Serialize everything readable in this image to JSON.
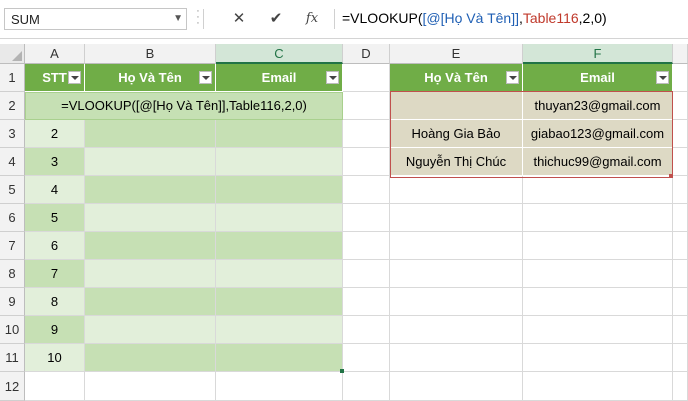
{
  "formula_bar": {
    "name_box": "SUM",
    "cancel_icon": "✕",
    "enter_icon": "✔",
    "fx_label": "fx",
    "formula_parts": [
      {
        "text": "=VLOOKUP(",
        "color": "#000000"
      },
      {
        "text": "[@[Họ Và Tên]]",
        "color": "#1f5fb4"
      },
      {
        "text": ",",
        "color": "#000000"
      },
      {
        "text": "Table116",
        "color": "#c0392b"
      },
      {
        "text": ",2,0)",
        "color": "#000000"
      }
    ]
  },
  "columns": [
    "A",
    "B",
    "C",
    "D",
    "E",
    "F"
  ],
  "rows": [
    "1",
    "2",
    "3",
    "4",
    "5",
    "6",
    "7",
    "8",
    "9",
    "10",
    "11",
    "12"
  ],
  "table_left": {
    "headers": [
      "STT",
      "Họ Và Tên",
      "Email"
    ],
    "stt": [
      "2",
      "3",
      "4",
      "5",
      "6",
      "7",
      "8",
      "9",
      "10"
    ]
  },
  "edit_cell": {
    "formula": "=VLOOKUP([@[Họ Và Tên]],Table116,2,0)"
  },
  "table_right": {
    "headers": [
      "Họ Và Tên",
      "Email"
    ],
    "rows": [
      {
        "name": "",
        "email": "thuyan23@gmail.com"
      },
      {
        "name": "Hoàng Gia Bảo",
        "email": "giabao123@gmail.com"
      },
      {
        "name": "Nguyễn Thị Chúc",
        "email": "thichuc99@gmail.com"
      }
    ]
  },
  "colors": {
    "header_green": "#70ad47",
    "band_light": "#e2efda",
    "band_dark": "#c6e0b4",
    "lookup_fill": "#ddd9c4",
    "lookup_border": "#c0504d",
    "excel_green": "#217346"
  }
}
